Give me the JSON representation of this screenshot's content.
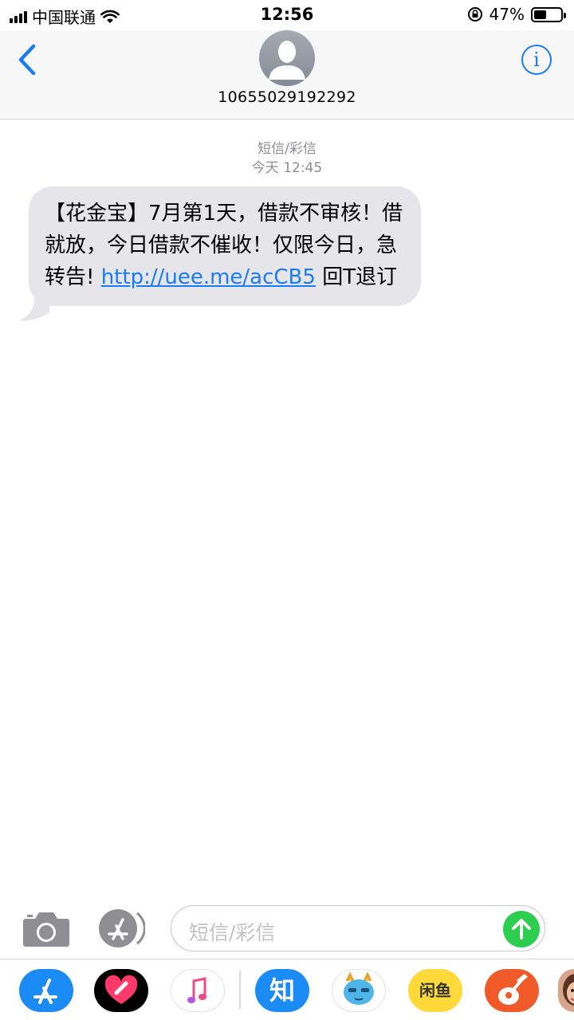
{
  "status_bar": {
    "carrier": "中国联通",
    "time": "12:56",
    "battery_percent": "47%",
    "battery_level": 0.47
  },
  "header": {
    "contact": "10655029192292"
  },
  "conversation": {
    "service_type": "短信/彩信",
    "timestamp": "今天 12:45",
    "message_text": "【花金宝】7月第1天，借款不审核！借就放，今日借款不催收！仅限今日，急转告! ",
    "message_link": "http://uee.me/acCB5",
    "message_suffix": " 回T退订"
  },
  "compose": {
    "placeholder": "短信/彩信"
  },
  "app_drawer": {
    "zhihu_label": "知",
    "xianyu_label": "闲鱼"
  },
  "colors": {
    "accent": "#1a7cf4",
    "bubble": "#e5e5ea",
    "send": "#2dcd4f"
  }
}
